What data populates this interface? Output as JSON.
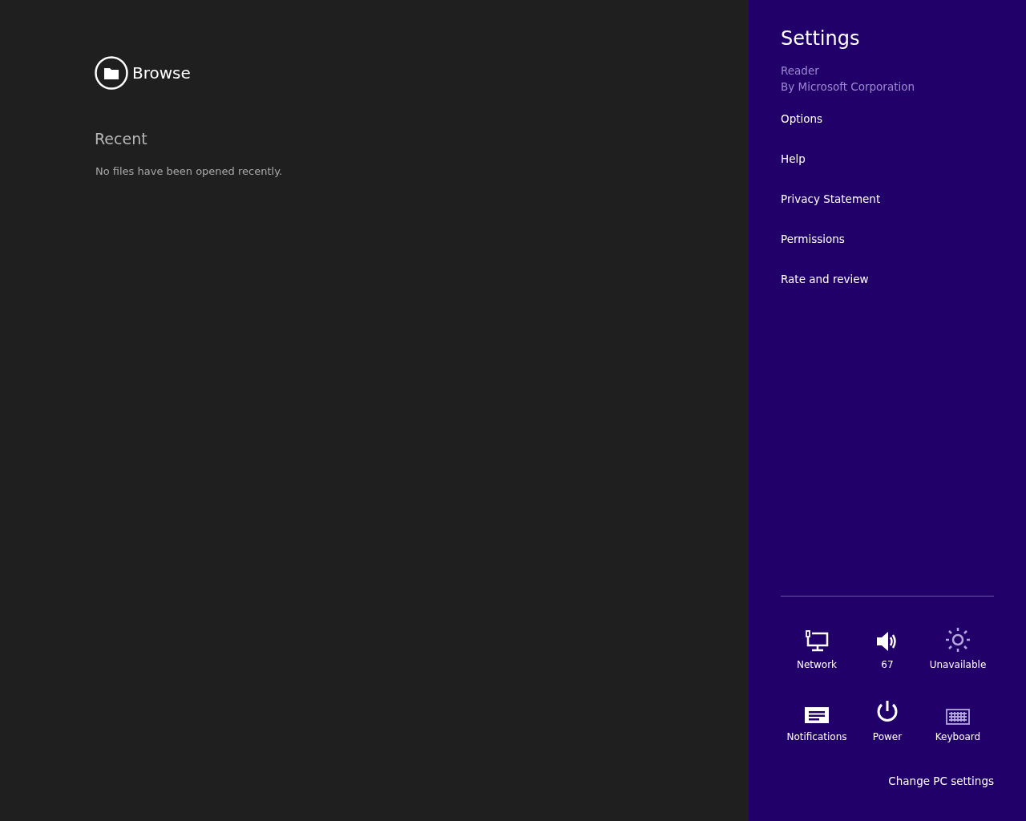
{
  "main": {
    "browse": {
      "label": "Browse"
    },
    "recent": {
      "heading": "Recent",
      "empty_message": "No files have been opened recently."
    }
  },
  "settings_pane": {
    "title": "Settings",
    "app_name": "Reader",
    "publisher": "By Microsoft Corporation",
    "items": [
      {
        "label": "Options"
      },
      {
        "label": "Help"
      },
      {
        "label": "Privacy Statement"
      },
      {
        "label": "Permissions"
      },
      {
        "label": "Rate and review"
      }
    ],
    "tiles": [
      {
        "kind": "network",
        "label": "Network",
        "disabled": false
      },
      {
        "kind": "volume",
        "label": "67",
        "disabled": false
      },
      {
        "kind": "brightness",
        "label": "Unavailable",
        "disabled": true
      },
      {
        "kind": "notifications",
        "label": "Notifications",
        "disabled": false
      },
      {
        "kind": "power",
        "label": "Power",
        "disabled": false
      },
      {
        "kind": "keyboard",
        "label": "Keyboard",
        "disabled": true
      }
    ],
    "footer_link": "Change PC settings"
  }
}
